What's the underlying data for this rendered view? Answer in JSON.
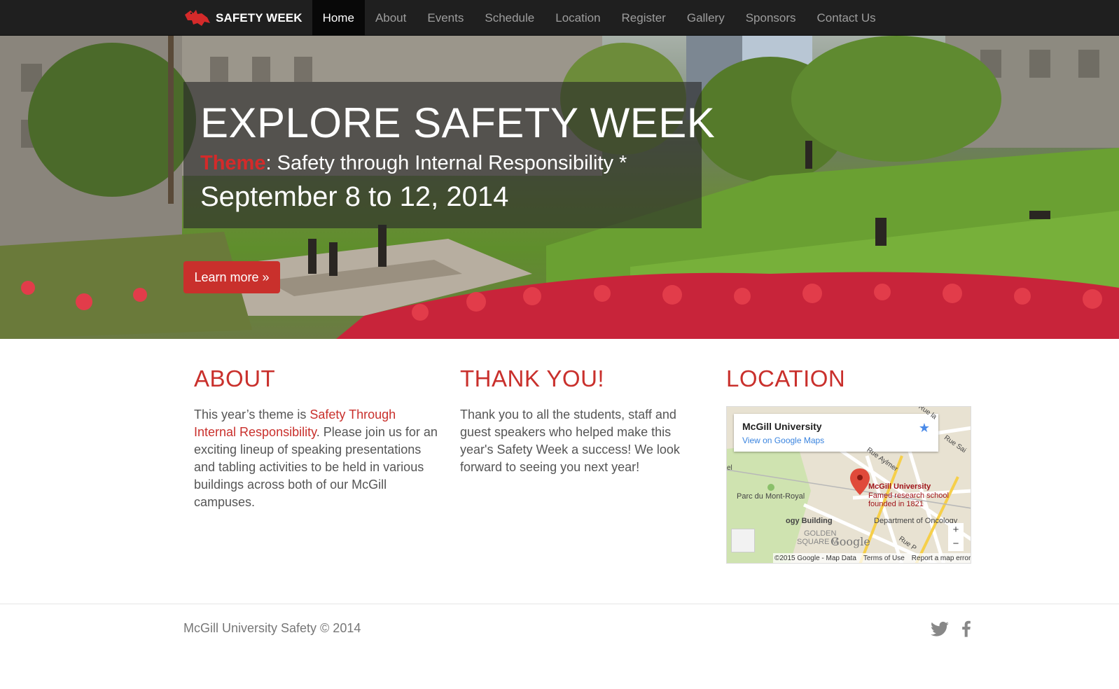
{
  "nav": {
    "brand": "SAFETY WEEK",
    "items": [
      {
        "label": "Home",
        "active": true
      },
      {
        "label": "About"
      },
      {
        "label": "Events"
      },
      {
        "label": "Schedule"
      },
      {
        "label": "Location"
      },
      {
        "label": "Register"
      },
      {
        "label": "Gallery"
      },
      {
        "label": "Sponsors"
      },
      {
        "label": "Contact Us"
      }
    ]
  },
  "hero": {
    "title": "EXPLORE SAFETY WEEK",
    "theme_label": "Theme",
    "theme_text": ": Safety through Internal Responsibility *",
    "dates": "September 8 to 12, 2014",
    "button": "Learn more »"
  },
  "about": {
    "heading": "ABOUT",
    "text_before": "This year’s theme is ",
    "link": "Safety Through Internal Responsibility",
    "text_after": ". Please join us for an exciting lineup of speaking presentations and tabling activities to be held in various buildings across both of our McGill campuses."
  },
  "thanks": {
    "heading": "THANK YOU!",
    "text": "Thank you to all the students, staff and guest speakers who helped make this year's Safety Week a success! We look forward to seeing you next year!"
  },
  "location": {
    "heading": "LOCATION",
    "map": {
      "card_title": "McGill University",
      "card_link": "View on Google Maps",
      "marker_title": "McGill University",
      "marker_desc_1": "Famed research school",
      "marker_desc_2": "founded in 1821",
      "label_park": "Parc du Mont-Royal",
      "label_building": "ogy Building",
      "label_oncology": "Department of Oncology",
      "label_golden_1": "GOLDEN",
      "label_golden_2": "SQUARE M",
      "label_aylmer": "Rue Aylmer",
      "label_rue_p": "Rue P",
      "label_rue_sai": "Rue Sai",
      "label_rue_la": "Rue la",
      "label_el": "el",
      "logo": "Google",
      "copyright": "©2015 Google - Map Data",
      "terms": "Terms of Use",
      "report": "Report a map error",
      "zoom_in": "+",
      "zoom_out": "−"
    }
  },
  "footer": {
    "copyright": "McGill University Safety © 2014",
    "social": [
      "twitter-icon",
      "facebook-icon"
    ]
  },
  "colors": {
    "accent": "#c9302c",
    "navbar": "#1f1f1f",
    "link": "#3a84df"
  }
}
